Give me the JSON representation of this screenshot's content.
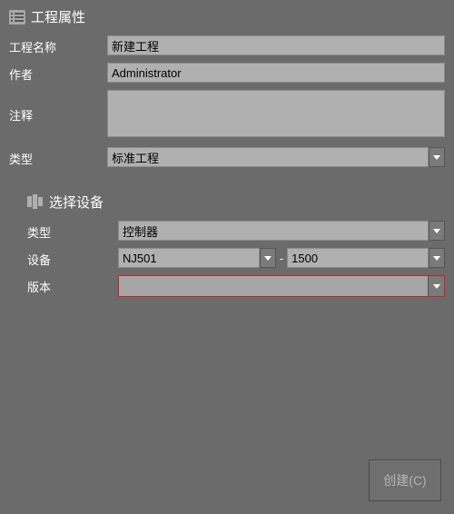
{
  "section1": {
    "title": "工程属性",
    "name_label": "工程名称",
    "name_value": "新建工程",
    "author_label": "作者",
    "author_value": "Administrator",
    "comment_label": "注释",
    "comment_value": "",
    "type_label": "类型",
    "type_value": "标准工程"
  },
  "section2": {
    "title": "选择设备",
    "type_label": "类型",
    "type_value": "控制器",
    "device_label": "设备",
    "device_model": "NJ501",
    "device_code": "1500",
    "version_label": "版本",
    "version_value": ""
  },
  "buttons": {
    "create": "创建(C)"
  }
}
